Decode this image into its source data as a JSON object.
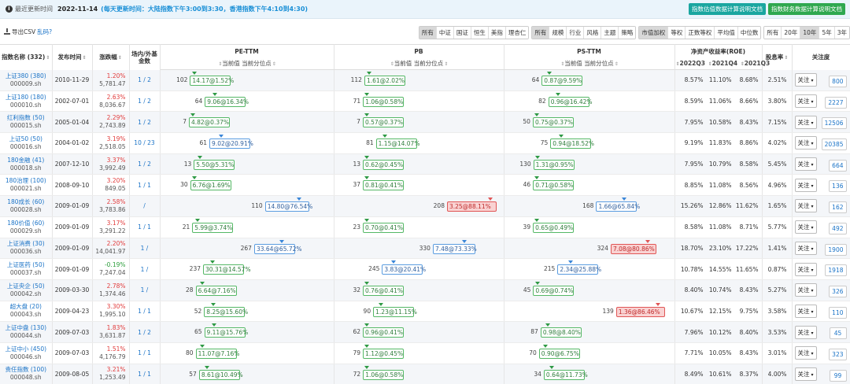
{
  "topbar": {
    "label": "最近更新时间",
    "date": "2022-11-14",
    "note": "(每天更新时间：大陆指数下午3:00到3:30，香港指数下午4:10到4:30)",
    "btn_valuation_doc": "指数估值数据计算说明文档",
    "btn_finance_doc": "指数财务数据计算说明文档"
  },
  "toolbar": {
    "export_label": "导出CSV",
    "export_link": "乱码?",
    "filter_groups": [
      {
        "items": [
          "所有",
          "中证",
          "国证",
          "恒生",
          "美指",
          "理杏仁"
        ],
        "active": 0
      },
      {
        "items": [
          "所有",
          "规模",
          "行业",
          "风格",
          "主题",
          "策略"
        ],
        "active": 0
      },
      {
        "items": [
          "市值加权",
          "等权",
          "正数等权",
          "平均值",
          "中位数"
        ],
        "active": 0
      },
      {
        "items": [
          "所有",
          "20年",
          "10年",
          "5年",
          "3年"
        ],
        "active": 2
      }
    ]
  },
  "table": {
    "headers": {
      "name": "指数名称 (332)",
      "date": "发布时间",
      "chg": "涨跌幅",
      "count": "场内/外基金数",
      "pe": "PE-TTM",
      "pb": "PB",
      "ps": "PS-TTM",
      "roe": "净资产收益率(ROE)",
      "div": "股息率",
      "follow": "关注度",
      "sub_cur": "当前值",
      "sub_pct": "当前分位点",
      "roe_q1": "2022Q3",
      "roe_q2": "2021Q4",
      "roe_q3": "2021Q3"
    },
    "rows": [
      {
        "name": "上证380 (380)",
        "code": "000009.sh",
        "date": "2010-11-29",
        "chg": "1.20%",
        "pts": "5,781.47",
        "count": "1 / 2",
        "pe_rank": "102",
        "pe": "14.17@1.52%",
        "pe_pct": 1.52,
        "pb_rank": "112",
        "pb": "1.61@2.02%",
        "pb_pct": 2.02,
        "ps_rank": "64",
        "ps": "0.87@9.59%",
        "ps_pct": 9.59,
        "roe1": "8.57%",
        "roe2": "11.10%",
        "roe3": "8.68%",
        "div": "2.51%",
        "follow": "关注",
        "fcount": "800"
      },
      {
        "name": "上证180 (180)",
        "code": "000010.sh",
        "date": "2002-07-01",
        "chg": "2.63%",
        "pts": "8,036.67",
        "count": "1 / 2",
        "pe_rank": "64",
        "pe": "9.06@16.34%",
        "pe_pct": 16.34,
        "pb_rank": "71",
        "pb": "1.06@0.58%",
        "pb_pct": 0.58,
        "ps_rank": "82",
        "ps": "0.96@16.42%",
        "ps_pct": 16.42,
        "roe1": "8.59%",
        "roe2": "11.06%",
        "roe3": "8.66%",
        "div": "3.80%",
        "follow": "关注",
        "fcount": "2227"
      },
      {
        "name": "红利指数 (50)",
        "code": "000015.sh",
        "date": "2005-01-04",
        "chg": "2.29%",
        "pts": "2,743.89",
        "count": "1 / 2",
        "pe_rank": "7",
        "pe": "4.82@0.37%",
        "pe_pct": 0.37,
        "pb_rank": "7",
        "pb": "0.57@0.37%",
        "pb_pct": 0.37,
        "ps_rank": "50",
        "ps": "0.75@0.37%",
        "ps_pct": 0.37,
        "roe1": "7.95%",
        "roe2": "10.58%",
        "roe3": "8.43%",
        "div": "7.15%",
        "follow": "关注",
        "fcount": "12506"
      },
      {
        "name": "上证50 (50)",
        "code": "000016.sh",
        "date": "2004-01-02",
        "chg": "3.19%",
        "pts": "2,518.05",
        "count": "10 / 23",
        "pe_rank": "61",
        "pe": "9.02@20.91%",
        "pe_pct": 20.91,
        "pb_rank": "81",
        "pb": "1.15@14.07%",
        "pb_pct": 14.07,
        "ps_rank": "75",
        "ps": "0.94@18.52%",
        "ps_pct": 18.52,
        "roe1": "9.19%",
        "roe2": "11.83%",
        "roe3": "8.86%",
        "div": "4.02%",
        "follow": "关注",
        "fcount": "20385"
      },
      {
        "name": "180金融 (41)",
        "code": "000018.sh",
        "date": "2007-12-10",
        "chg": "3.37%",
        "pts": "3,992.49",
        "count": "1 / 2",
        "pe_rank": "13",
        "pe": "5.50@5.31%",
        "pe_pct": 5.31,
        "pb_rank": "13",
        "pb": "0.62@0.45%",
        "pb_pct": 0.45,
        "ps_rank": "130",
        "ps": "1.31@0.95%",
        "ps_pct": 0.95,
        "roe1": "7.95%",
        "roe2": "10.79%",
        "roe3": "8.58%",
        "div": "5.45%",
        "follow": "关注",
        "fcount": "664"
      },
      {
        "name": "180治理 (100)",
        "code": "000021.sh",
        "date": "2008-09-10",
        "chg": "3.20%",
        "pts": "849.05",
        "count": "1 / 1",
        "pe_rank": "30",
        "pe": "6.76@1.69%",
        "pe_pct": 1.69,
        "pb_rank": "37",
        "pb": "0.81@0.41%",
        "pb_pct": 0.41,
        "ps_rank": "46",
        "ps": "0.71@0.58%",
        "ps_pct": 0.58,
        "roe1": "8.85%",
        "roe2": "11.08%",
        "roe3": "8.56%",
        "div": "4.96%",
        "follow": "关注",
        "fcount": "136"
      },
      {
        "name": "180成长 (60)",
        "code": "000028.sh",
        "date": "2009-01-09",
        "chg": "2.58%",
        "pts": "3,783.86",
        "count": "/",
        "pe_rank": "110",
        "pe": "14.80@76.54%",
        "pe_pct": 76.54,
        "pb_rank": "208",
        "pb": "3.25@88.11%",
        "pb_pct": 88.11,
        "ps_rank": "168",
        "ps": "1.66@65.84%",
        "ps_pct": 65.84,
        "roe1": "15.26%",
        "roe2": "12.86%",
        "roe3": "11.62%",
        "div": "1.65%",
        "follow": "关注",
        "fcount": "162"
      },
      {
        "name": "180价值 (60)",
        "code": "000029.sh",
        "date": "2009-01-09",
        "chg": "3.17%",
        "pts": "3,291.22",
        "count": "1 / 1",
        "pe_rank": "21",
        "pe": "5.99@3.74%",
        "pe_pct": 3.74,
        "pb_rank": "23",
        "pb": "0.70@0.41%",
        "pb_pct": 0.41,
        "ps_rank": "39",
        "ps": "0.65@0.49%",
        "ps_pct": 0.49,
        "roe1": "8.58%",
        "roe2": "11.08%",
        "roe3": "8.71%",
        "div": "5.77%",
        "follow": "关注",
        "fcount": "492"
      },
      {
        "name": "上证消费 (30)",
        "code": "000036.sh",
        "date": "2009-01-09",
        "chg": "2.20%",
        "pts": "14,041.97",
        "count": "1 /",
        "pe_rank": "267",
        "pe": "33.64@65.72%",
        "pe_pct": 65.72,
        "pb_rank": "330",
        "pb": "7.48@73.33%",
        "pb_pct": 73.33,
        "ps_rank": "324",
        "ps": "7.08@80.86%",
        "ps_pct": 80.86,
        "roe1": "18.70%",
        "roe2": "23.10%",
        "roe3": "17.22%",
        "div": "1.41%",
        "follow": "关注",
        "fcount": "1900"
      },
      {
        "name": "上证医药 (50)",
        "code": "000037.sh",
        "date": "2009-01-09",
        "chg": "-0.19%",
        "pts": "7,247.04",
        "count": "1 /",
        "pe_rank": "237",
        "pe": "30.31@14.57%",
        "pe_pct": 14.57,
        "pb_rank": "245",
        "pb": "3.83@20.41%",
        "pb_pct": 20.41,
        "ps_rank": "215",
        "ps": "2.34@25.88%",
        "ps_pct": 25.88,
        "roe1": "10.78%",
        "roe2": "14.55%",
        "roe3": "11.65%",
        "div": "0.87%",
        "follow": "关注",
        "fcount": "1918"
      },
      {
        "name": "上证央企 (50)",
        "code": "000042.sh",
        "date": "2009-03-30",
        "chg": "2.78%",
        "pts": "1,374.46",
        "count": "1 /",
        "pe_rank": "28",
        "pe": "6.64@7.16%",
        "pe_pct": 7.16,
        "pb_rank": "32",
        "pb": "0.76@0.41%",
        "pb_pct": 0.41,
        "ps_rank": "45",
        "ps": "0.69@0.74%",
        "ps_pct": 0.74,
        "roe1": "8.40%",
        "roe2": "10.74%",
        "roe3": "8.43%",
        "div": "5.27%",
        "follow": "关注",
        "fcount": "326"
      },
      {
        "name": "超大盘 (20)",
        "code": "000043.sh",
        "date": "2009-04-23",
        "chg": "3.30%",
        "pts": "1,995.10",
        "count": "1 / 1",
        "pe_rank": "52",
        "pe": "8.25@15.60%",
        "pe_pct": 15.6,
        "pb_rank": "90",
        "pb": "1.23@11.15%",
        "pb_pct": 11.15,
        "ps_rank": "139",
        "ps": "1.36@86.46%",
        "ps_pct": 86.46,
        "roe1": "10.67%",
        "roe2": "12.15%",
        "roe3": "9.75%",
        "div": "3.58%",
        "follow": "关注",
        "fcount": "110"
      },
      {
        "name": "上证中盘 (130)",
        "code": "000044.sh",
        "date": "2009-07-03",
        "chg": "1.83%",
        "pts": "3,631.87",
        "count": "1 / 2",
        "pe_rank": "65",
        "pe": "9.11@15.76%",
        "pe_pct": 15.76,
        "pb_rank": "62",
        "pb": "0.96@0.41%",
        "pb_pct": 0.41,
        "ps_rank": "87",
        "ps": "0.98@8.40%",
        "ps_pct": 8.4,
        "roe1": "7.96%",
        "roe2": "10.12%",
        "roe3": "8.40%",
        "div": "3.53%",
        "follow": "关注",
        "fcount": "45"
      },
      {
        "name": "上证中小 (450)",
        "code": "000046.sh",
        "date": "2009-07-03",
        "chg": "1.51%",
        "pts": "4,176.79",
        "count": "1 / 1",
        "pe_rank": "80",
        "pe": "11.07@7.16%",
        "pe_pct": 7.16,
        "pb_rank": "79",
        "pb": "1.12@0.45%",
        "pb_pct": 0.45,
        "ps_rank": "70",
        "ps": "0.90@6.75%",
        "ps_pct": 6.75,
        "roe1": "7.71%",
        "roe2": "10.05%",
        "roe3": "8.43%",
        "div": "3.01%",
        "follow": "关注",
        "fcount": "323"
      },
      {
        "name": "责任指数 (100)",
        "code": "000048.sh",
        "date": "2009-08-05",
        "chg": "3.21%",
        "pts": "1,253.49",
        "count": "1 / 1",
        "pe_rank": "57",
        "pe": "8.61@10.49%",
        "pe_pct": 10.49,
        "pb_rank": "72",
        "pb": "1.06@0.58%",
        "pb_pct": 0.58,
        "ps_rank": "34",
        "ps": "0.64@11.73%",
        "ps_pct": 11.73,
        "roe1": "8.49%",
        "roe2": "10.61%",
        "roe3": "8.37%",
        "div": "4.00%",
        "follow": "关注",
        "fcount": "99"
      }
    ]
  }
}
